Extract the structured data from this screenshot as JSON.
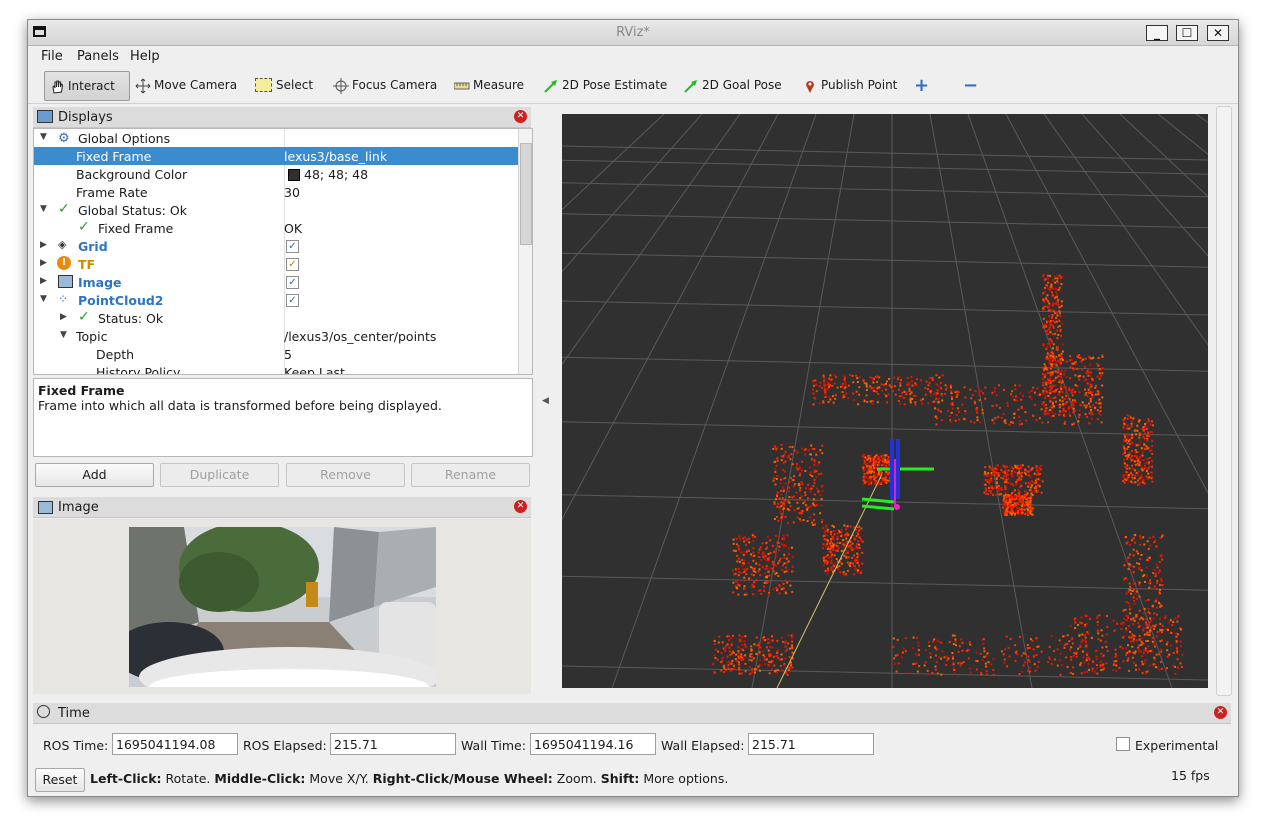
{
  "window": {
    "title": "RViz*",
    "minimize_label": "_",
    "maximize_label": "☐",
    "close_label": "✕"
  },
  "menu": [
    "File",
    "Panels",
    "Help"
  ],
  "toolbar": {
    "interact": "Interact",
    "move_camera": "Move Camera",
    "select": "Select",
    "focus_camera": "Focus Camera",
    "measure": "Measure",
    "pose_estimate": "2D Pose Estimate",
    "goal_pose": "2D Goal Pose",
    "publish_point": "Publish Point",
    "add_tool": "+",
    "remove_tool": "−"
  },
  "displays": {
    "title": "Displays",
    "rows": [
      {
        "label": "Global Options",
        "value": ""
      },
      {
        "label": "Fixed Frame",
        "value": "lexus3/base_link"
      },
      {
        "label": "Background Color",
        "value": "48; 48; 48"
      },
      {
        "label": "Frame Rate",
        "value": "30"
      },
      {
        "label": "Global Status: Ok",
        "value": ""
      },
      {
        "label": "Fixed Frame",
        "value": "OK"
      },
      {
        "label": "Grid",
        "value": ""
      },
      {
        "label": "TF",
        "value": ""
      },
      {
        "label": "Image",
        "value": ""
      },
      {
        "label": "PointCloud2",
        "value": ""
      },
      {
        "label": "Status: Ok",
        "value": ""
      },
      {
        "label": "Topic",
        "value": "/lexus3/os_center/points"
      },
      {
        "label": "Depth",
        "value": "5"
      },
      {
        "label": "History Policy",
        "value": "Keep Last"
      }
    ],
    "checkmark": "✓",
    "background_color_hex": "#303030",
    "desc_title": "Fixed Frame",
    "desc_text": "Frame into which all data is transformed before being displayed.",
    "buttons": {
      "add": "Add",
      "duplicate": "Duplicate",
      "remove": "Remove",
      "rename": "Rename"
    }
  },
  "image_panel": {
    "title": "Image"
  },
  "time_panel": {
    "title": "Time",
    "ros_time_label": "ROS Time:",
    "ros_time": "1695041194.08",
    "ros_elapsed_label": "ROS Elapsed:",
    "ros_elapsed": "215.71",
    "wall_time_label": "Wall Time:",
    "wall_time": "1695041194.16",
    "wall_elapsed_label": "Wall Elapsed:",
    "wall_elapsed": "215.71",
    "experimental_label": "Experimental"
  },
  "status": {
    "reset": "Reset",
    "left_click_key": "Left-Click:",
    "left_click_val": " Rotate. ",
    "middle_click_key": "Middle-Click:",
    "middle_click_val": " Move X/Y. ",
    "right_click_key": "Right-Click/Mouse Wheel:",
    "right_click_val": " Zoom. ",
    "shift_key": "Shift:",
    "shift_val": " More options.",
    "fps": "15 fps"
  },
  "colors": {
    "selection": "#3a8ccf",
    "link_blue": "#2b75c2",
    "tf_orange": "#d08b00",
    "pointcloud_red": "#ff2a00"
  }
}
